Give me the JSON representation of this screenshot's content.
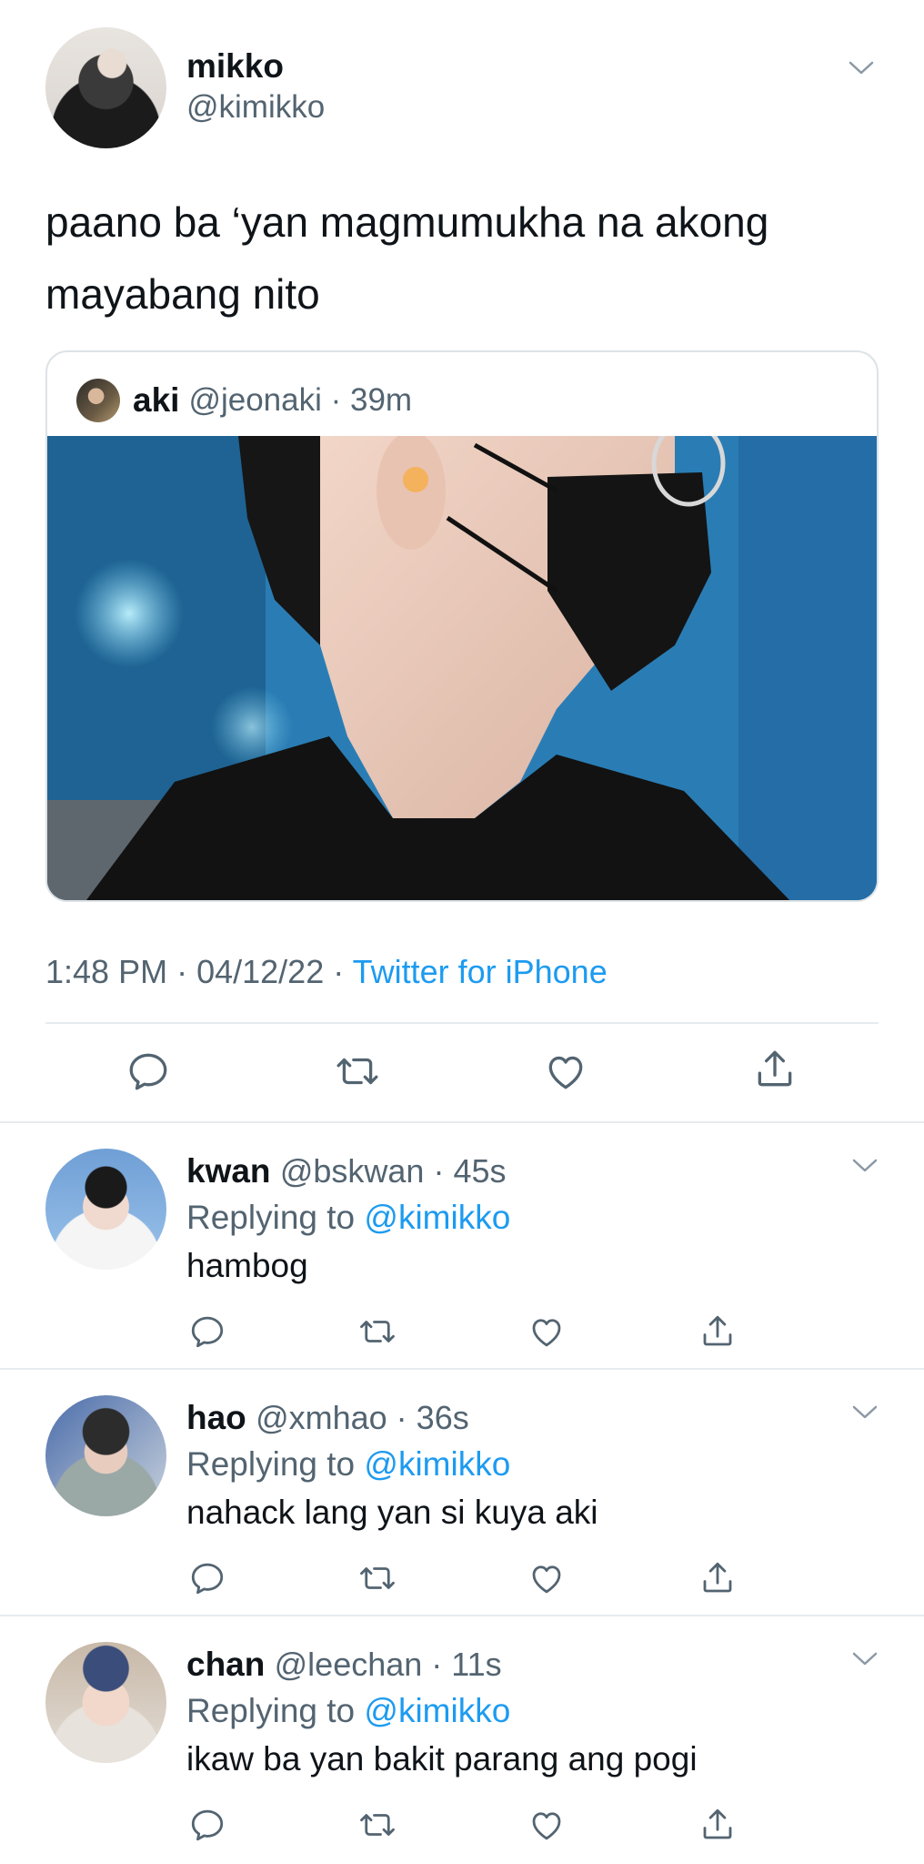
{
  "main_tweet": {
    "author_name": "mikko",
    "author_handle": "@kimikko",
    "text": "paano ba ‘yan magmumukha na akong mayabang nito",
    "quoted": {
      "name": "aki",
      "handle": "@jeonaki",
      "time": "39m"
    },
    "time": "1:48 PM",
    "date": "04/12/22",
    "source": "Twitter for iPhone"
  },
  "icons": [
    "avatar",
    "chevron-down-icon",
    "reply-icon",
    "retweet-icon",
    "like-icon",
    "share-icon"
  ],
  "colors": {
    "link": "#1d9bf0",
    "secondary_text": "#536471",
    "primary_text": "#0f1419",
    "divider": "#e6ebee"
  },
  "replies": [
    {
      "name": "kwan",
      "handle": "@bskwan",
      "time": "45s",
      "replying_prefix": "Replying to ",
      "replying_to": "@kimikko",
      "text": "hambog"
    },
    {
      "name": "hao",
      "handle": "@xmhao",
      "time": "36s",
      "replying_prefix": "Replying to ",
      "replying_to": "@kimikko",
      "text": "nahack lang yan si kuya aki"
    },
    {
      "name": "chan",
      "handle": "@leechan",
      "time": "11s",
      "replying_prefix": "Replying to ",
      "replying_to": "@kimikko",
      "text": "ikaw ba yan bakit parang ang pogi"
    }
  ]
}
